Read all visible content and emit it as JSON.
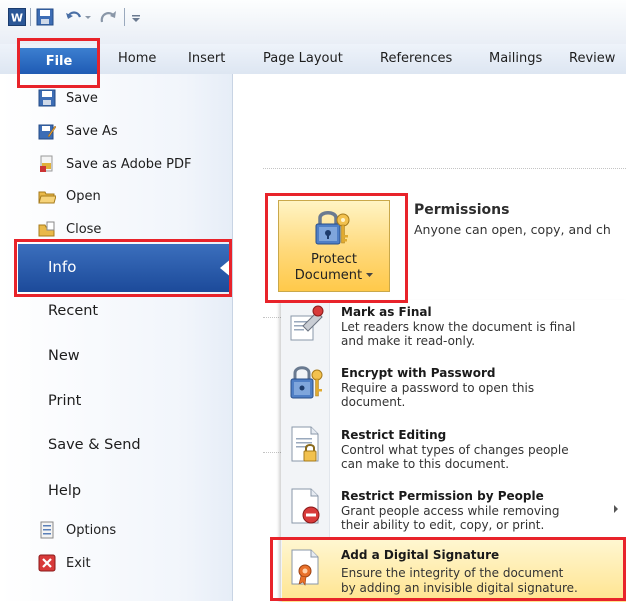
{
  "ribbon": {
    "file": "File",
    "tabs": [
      "Home",
      "Insert",
      "Page Layout",
      "References",
      "Mailings",
      "Review"
    ]
  },
  "nav": {
    "small_top": [
      {
        "label": "Save",
        "icon": "save-icon"
      },
      {
        "label": "Save As",
        "icon": "save-as-icon"
      },
      {
        "label": "Save as Adobe PDF",
        "icon": "adobe-pdf-icon"
      },
      {
        "label": "Open",
        "icon": "open-folder-icon"
      },
      {
        "label": "Close",
        "icon": "close-folder-icon"
      }
    ],
    "info": "Info",
    "large": [
      "Recent",
      "New",
      "Print",
      "Save & Send",
      "Help"
    ],
    "small_bottom": [
      {
        "label": "Options",
        "icon": "options-icon"
      },
      {
        "label": "Exit",
        "icon": "exit-icon"
      }
    ]
  },
  "permissions": {
    "button_line1": "Protect",
    "button_line2": "Document",
    "title": "Permissions",
    "description": "Anyone can open, copy, and ch"
  },
  "menu": [
    {
      "title": "Mark as Final",
      "d1": "Let readers know the document is final",
      "d2": "and make it read-only.",
      "icon": "mark-final-icon"
    },
    {
      "title": "Encrypt with Password",
      "d1": "Require a password to open this",
      "d2": "document.",
      "icon": "padlock-key-icon"
    },
    {
      "title": "Restrict Editing",
      "d1": "Control what types of changes people",
      "d2": "can make to this document.",
      "icon": "restrict-editing-icon"
    },
    {
      "title": "Restrict Permission by People",
      "d1": "Grant people access while removing",
      "d2": "their ability to edit, copy, or print.",
      "icon": "restrict-permission-icon"
    },
    {
      "title": "Add a Digital Signature",
      "d1": "Ensure the integrity of the document",
      "d2": "by adding an invisible digital signature.",
      "icon": "digital-signature-icon"
    }
  ],
  "colors": {
    "accent_blue": "#2a62b9",
    "highlight_red": "#e8232a",
    "button_gold": "#ffd97a"
  }
}
